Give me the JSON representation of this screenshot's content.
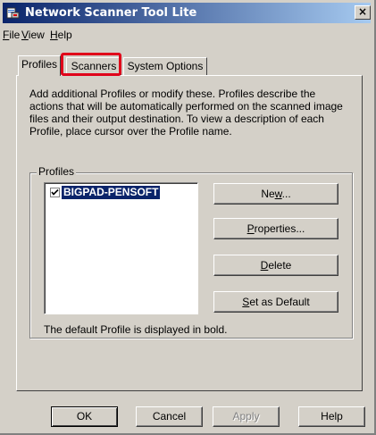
{
  "window": {
    "title": "Network Scanner Tool Lite",
    "close_glyph": "×",
    "icon": "scanner-app-icon"
  },
  "menu": [
    {
      "label_ul": "F",
      "label_rest": "ile"
    },
    {
      "label_ul": "V",
      "label_rest": "iew"
    },
    {
      "label_ul": "H",
      "label_rest": "elp"
    }
  ],
  "tabs": [
    {
      "label": "Profiles",
      "active": true
    },
    {
      "label": "Scanners",
      "highlighted": true
    },
    {
      "label": "System Options"
    }
  ],
  "profiles_tab": {
    "description": "Add additional Profiles or modify these. Profiles describe the actions that will be automatically performed on the scanned image files and their output destination. To view a description of each  Profile, place cursor over the Profile name.",
    "group_label": "Profiles",
    "list": [
      {
        "name": "BIGPAD-PENSOFT",
        "checked": true,
        "selected": true,
        "is_default": true
      }
    ],
    "buttons": {
      "new_pre": "Ne",
      "new_ul": "w",
      "new_post": "...",
      "props_ul": "P",
      "props_post": "roperties...",
      "delete_ul": "D",
      "delete_post": "elete",
      "default_ul": "S",
      "default_post": "et as Default"
    },
    "footnote": "The default Profile is displayed in bold."
  },
  "dialog_buttons": {
    "ok": "OK",
    "cancel": "Cancel",
    "apply": "Apply",
    "help": "Help"
  },
  "colors": {
    "title_gradient_start": "#0a246a",
    "title_gradient_end": "#a6caf0",
    "highlight_border": "#e0001a",
    "selection_bg": "#0a246a",
    "face": "#d4d0c8"
  }
}
